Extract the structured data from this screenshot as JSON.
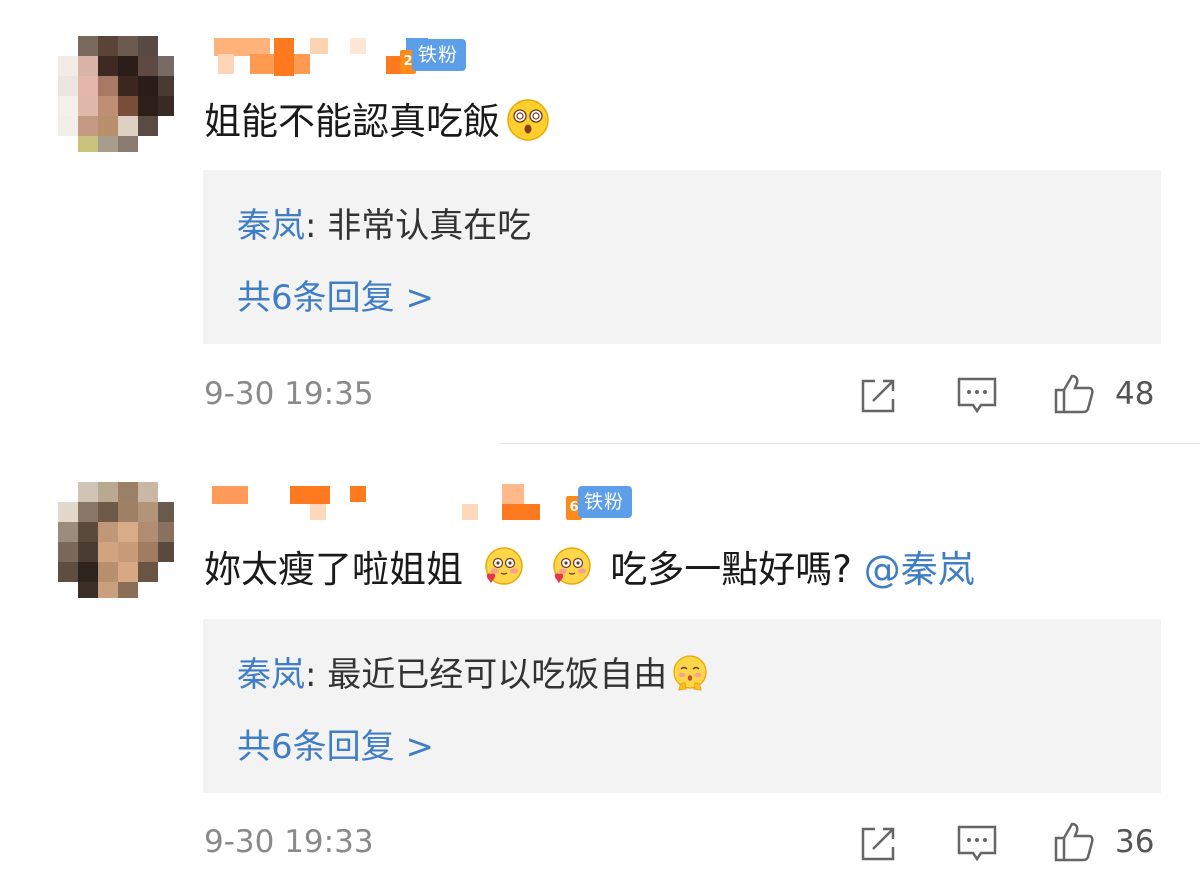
{
  "comments": [
    {
      "fan_badge": "铁粉",
      "fan_level": "2",
      "text": "姐能不能認真吃飯",
      "text_emoji": "dizzy-face-emoji",
      "reply": {
        "author": "秦岚",
        "sep": ": ",
        "text": "非常认真在吃",
        "emoji": ""
      },
      "reply_more": "共6条回复 >",
      "time": "9-30 19:35",
      "likes": "48"
    },
    {
      "fan_badge": "铁粉",
      "fan_level": "6",
      "text_before": "妳太瘦了啦姐姐",
      "text_emojis": [
        "love-face-emoji",
        "love-face-emoji"
      ],
      "text_after": "吃多一點好嗎?",
      "mention": "@秦岚",
      "reply": {
        "author": "秦岚",
        "sep": ": ",
        "text": "最近已经可以吃饭自由",
        "emoji": "shy-face-emoji"
      },
      "reply_more": "共6条回复 >",
      "time": "9-30 19:33",
      "likes": "36"
    }
  ],
  "icons": {
    "share": "share-icon",
    "comment": "comment-icon",
    "like": "thumbs-up-icon"
  },
  "colors": {
    "link": "#3f7ec4",
    "badge": "#5c9ee8",
    "name_blur": "#ff7a1f",
    "reply_bg": "#f3f3f3"
  }
}
